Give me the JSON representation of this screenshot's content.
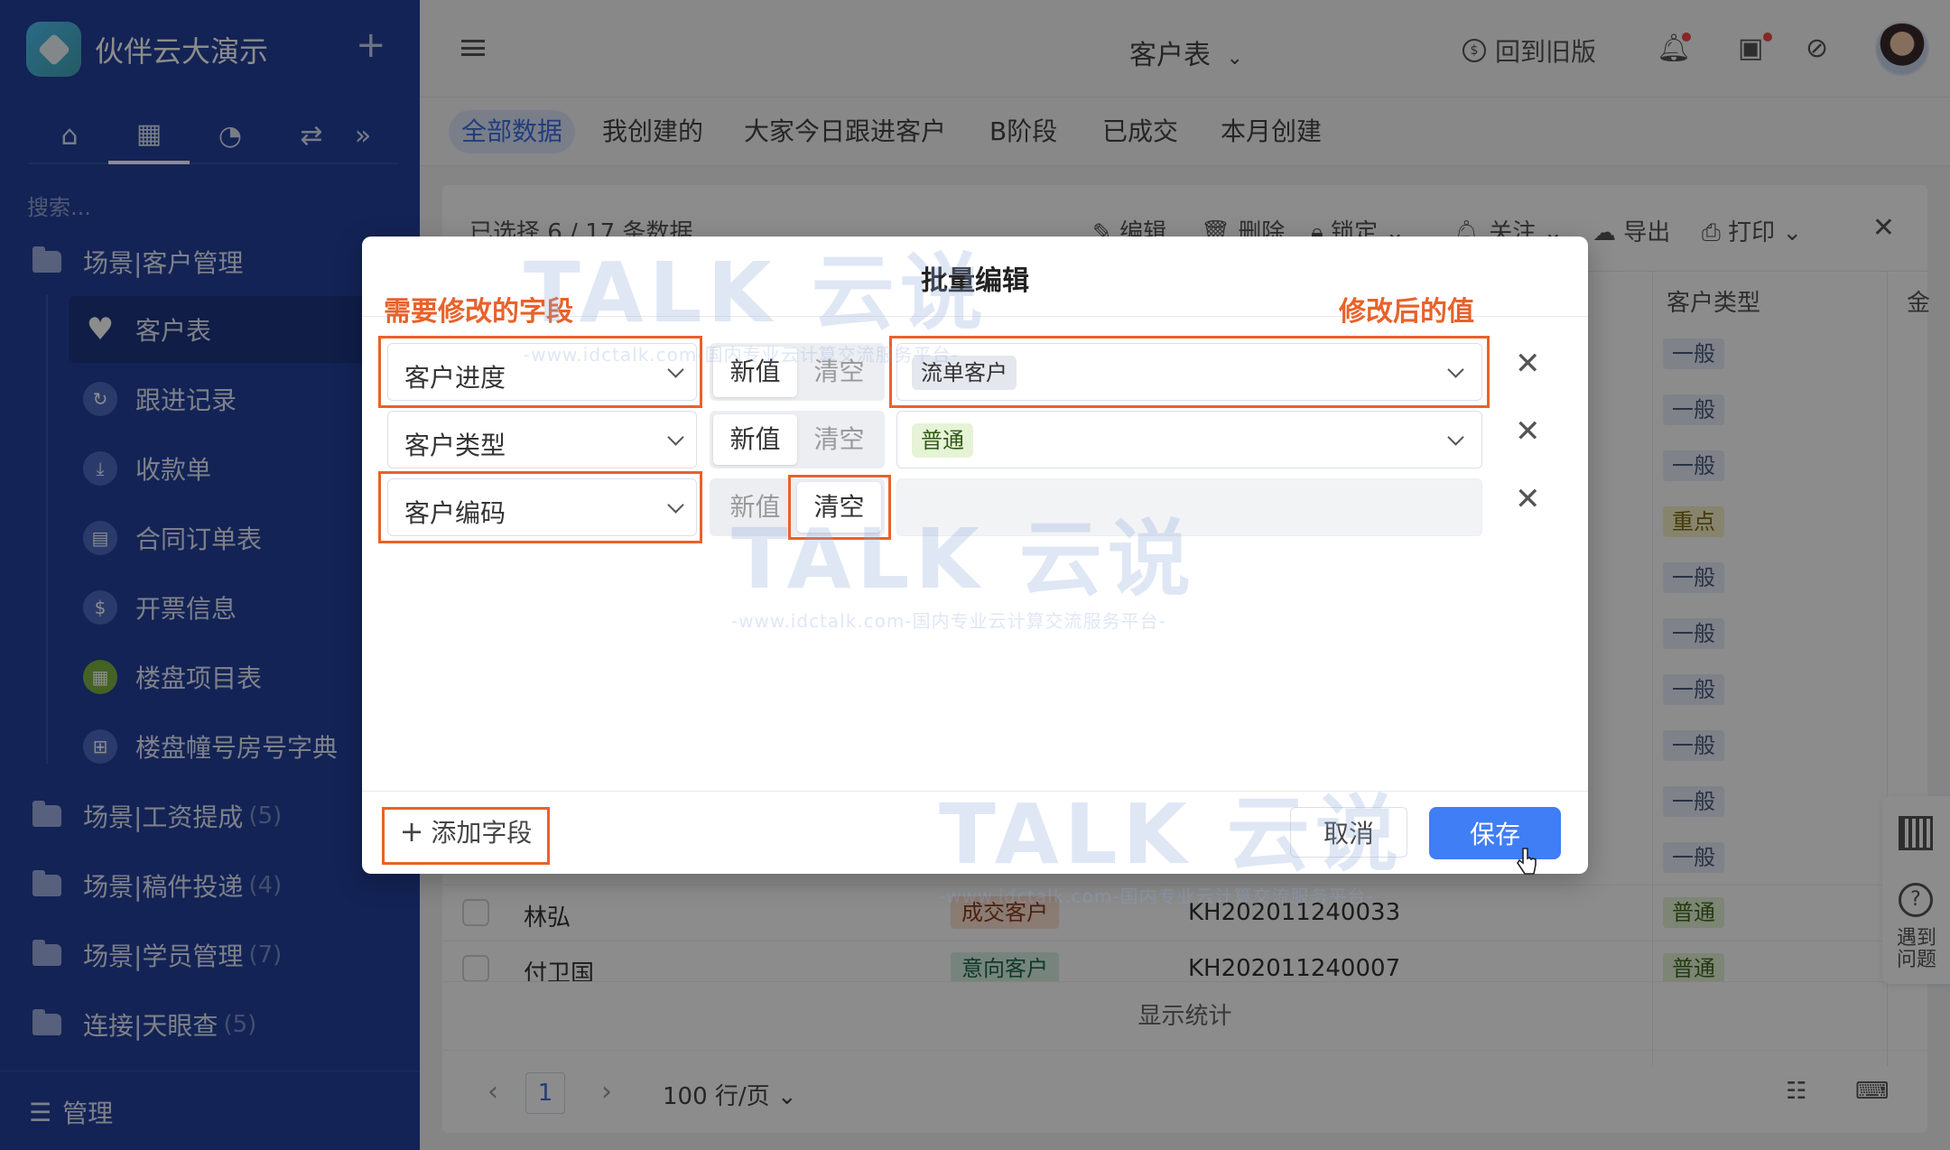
{
  "app": {
    "name": "伙伴云大演示",
    "add_symbol": "+"
  },
  "sidebar": {
    "search_placeholder": "搜索...",
    "folders": [
      {
        "label": "场景|客户管理",
        "count": ""
      },
      {
        "label": "场景|工资提成",
        "count": "(5)"
      },
      {
        "label": "场景|稿件投递",
        "count": "(4)"
      },
      {
        "label": "场景|学员管理",
        "count": "(7)"
      },
      {
        "label": "连接|天眼查",
        "count": "(5)"
      }
    ],
    "items": [
      {
        "label": "客户表",
        "icon": "heart-icon",
        "glyph": "♥"
      },
      {
        "label": "跟进记录",
        "icon": "refresh-icon",
        "glyph": "↻"
      },
      {
        "label": "收款单",
        "icon": "download-icon",
        "glyph": "⤓"
      },
      {
        "label": "合同订单表",
        "icon": "document-icon",
        "glyph": "▤"
      },
      {
        "label": "开票信息",
        "icon": "dollar-icon",
        "glyph": "$"
      },
      {
        "label": "楼盘项目表",
        "icon": "calendar-icon",
        "glyph": "▦"
      },
      {
        "label": "楼盘幢号房号字典",
        "icon": "grid-icon",
        "glyph": "⊞"
      }
    ],
    "manage_label": "管理"
  },
  "topbar": {
    "sheet_title": "客户表",
    "back_label": "回到旧版"
  },
  "view_tabs": [
    "全部数据",
    "我创建的",
    "大家今日跟进客户",
    "B阶段",
    "已成交",
    "本月创建"
  ],
  "grid": {
    "selection_text": "已选择 6 / 17 条数据",
    "toolbar": {
      "edit": "编辑",
      "delete": "删除",
      "lock": "锁定",
      "follow": "关注",
      "export": "导出",
      "print": "打印"
    },
    "columns": {
      "customer_type": "客户类型",
      "amount_partial": "金"
    },
    "type_tags": [
      "一般",
      "一般",
      "一般",
      "重点",
      "一般",
      "一般",
      "一般",
      "一般",
      "一般",
      "一般"
    ],
    "rows": [
      {
        "name": "林弘",
        "status": "成交客户",
        "code": "KH202011240033",
        "type": "普通"
      },
      {
        "name": "付卫国",
        "status": "意向客户",
        "code": "KH202011240007",
        "type": "普通"
      }
    ],
    "stats_label": "显示统计",
    "pager": {
      "page": "1",
      "page_size": "100 行/页"
    }
  },
  "float_panel": {
    "help_label": "遇到问题"
  },
  "modal": {
    "title": "批量编辑",
    "annotation_left": "需要修改的字段",
    "annotation_right": "修改后的值",
    "rows": [
      {
        "field": "客户进度",
        "new_label": "新值",
        "clear_label": "清空",
        "value": "流单客户"
      },
      {
        "field": "客户类型",
        "new_label": "新值",
        "clear_label": "清空",
        "value": "普通"
      },
      {
        "field": "客户编码",
        "new_label": "新值",
        "clear_label": "清空",
        "value": ""
      }
    ],
    "add_field_label": "添加字段",
    "cancel_label": "取消",
    "save_label": "保存"
  },
  "watermark": {
    "brand": "TALK 云说",
    "tagline": "-www.idctalk.com-国内专业云计算交流服务平台-"
  },
  "colors": {
    "sidebar_bg": "#23409b",
    "accent": "#3f7ef5",
    "annotation": "#e8622a"
  }
}
